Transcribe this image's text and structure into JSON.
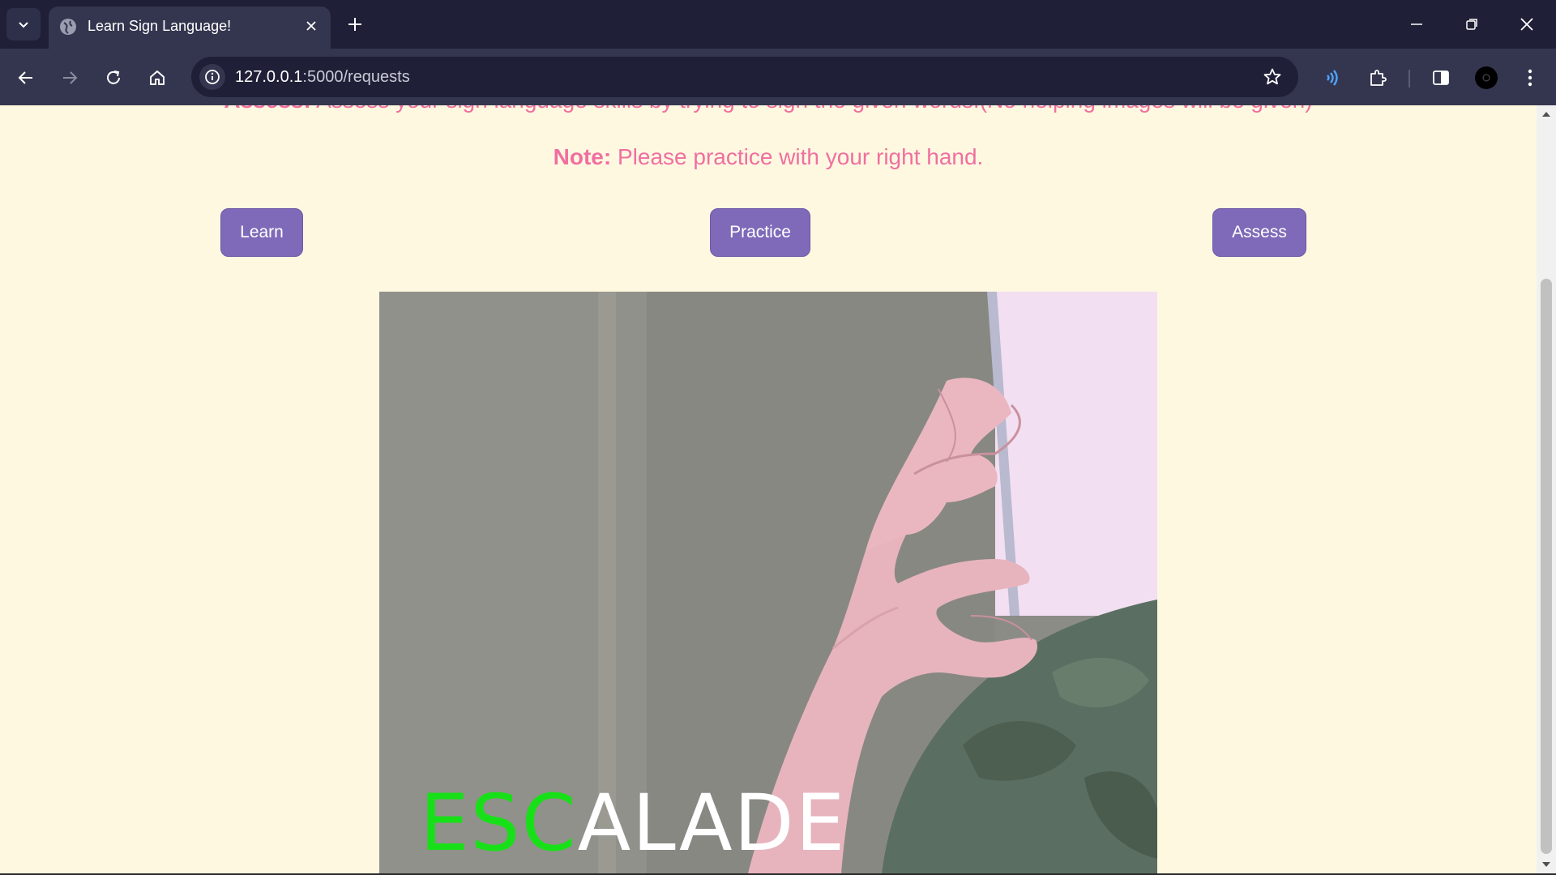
{
  "browser": {
    "tab_title": "Learn Sign Language!",
    "url_host": "127.0.0.1",
    "url_path": ":5000/requests",
    "icons": [
      "tab-search-icon",
      "globe-icon",
      "close-icon",
      "plus-icon",
      "minimize-icon",
      "restore-icon",
      "close-window-icon",
      "back-icon",
      "forward-icon",
      "reload-icon",
      "home-icon",
      "site-info-icon",
      "star-icon",
      "read-aloud-icon",
      "extensions-icon",
      "side-panel-icon",
      "profile-avatar-icon"
    ]
  },
  "page": {
    "assess_label": "Assess:",
    "assess_text": " Assess your sign language skills by trying to sign the given words.(No helping images will be given)",
    "note_label": "Note:",
    "note_text": " Please practice with your right hand.",
    "buttons": {
      "learn": "Learn",
      "practice": "Practice",
      "assess": "Assess"
    },
    "video": {
      "word_done": "ESC",
      "word_remaining": "ALADE"
    }
  },
  "colors": {
    "page_background": "#fff8e1",
    "text_accent": "#f06fa0",
    "button_background": "#7e6ab8",
    "word_done": "#18e018",
    "word_remaining": "#ffffff"
  }
}
